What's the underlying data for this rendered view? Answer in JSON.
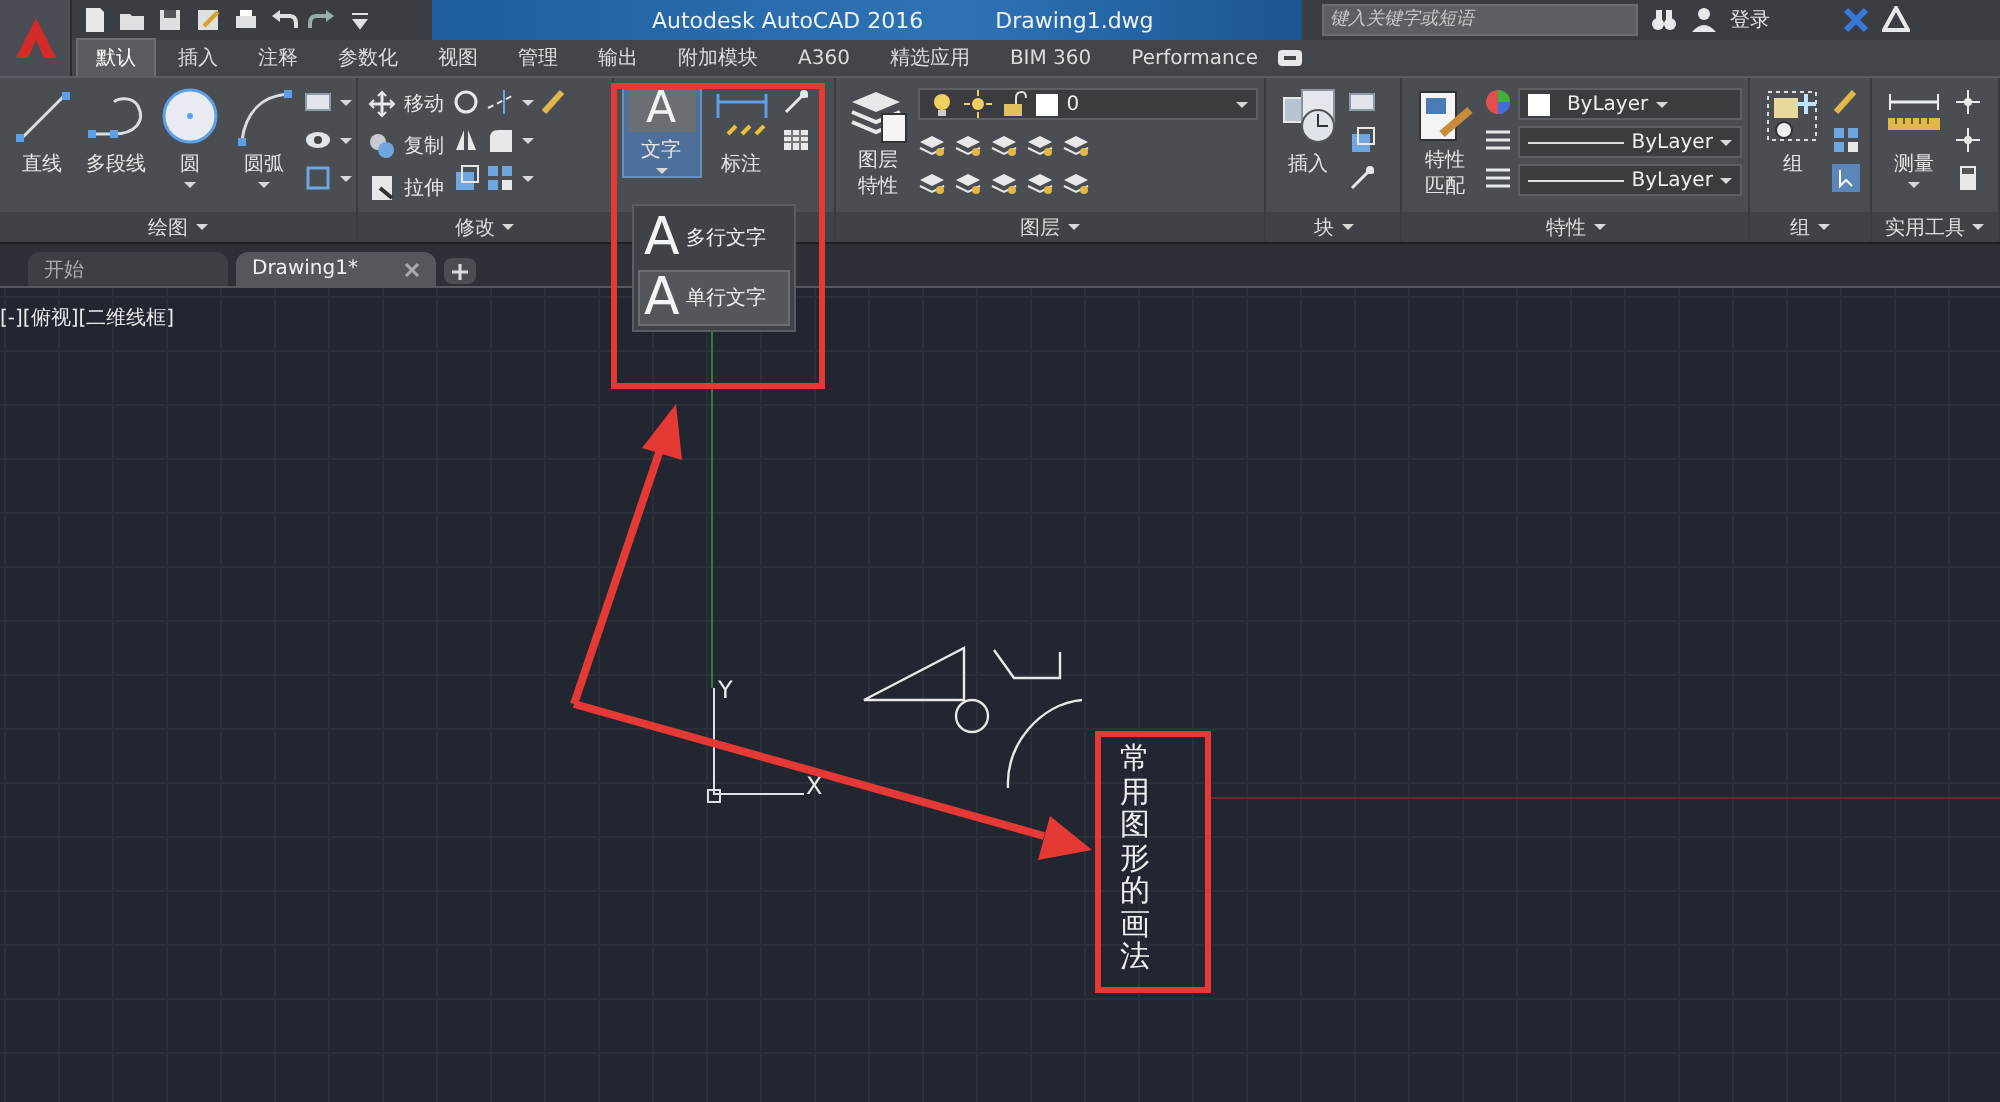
{
  "title_bar": {
    "title": "Autodesk AutoCAD 2016",
    "document": "Drawing1.dwg",
    "search": {
      "placeholder": "键入关键字或短语"
    },
    "sign_in": "登录"
  },
  "ribbon_tabs": [
    {
      "label": "默认",
      "selected": true
    },
    {
      "label": "插入",
      "selected": false
    },
    {
      "label": "注释",
      "selected": false
    },
    {
      "label": "参数化",
      "selected": false
    },
    {
      "label": "视图",
      "selected": false
    },
    {
      "label": "管理",
      "selected": false
    },
    {
      "label": "输出",
      "selected": false
    },
    {
      "label": "附加模块",
      "selected": false
    },
    {
      "label": "A360",
      "selected": false
    },
    {
      "label": "精选应用",
      "selected": false
    },
    {
      "label": "BIM 360",
      "selected": false
    },
    {
      "label": "Performance",
      "selected": false
    }
  ],
  "ribbon_panels": [
    {
      "kind": "draw",
      "title": "绘图",
      "tools": [
        {
          "kind": "line",
          "label": "直线"
        },
        {
          "kind": "polyline",
          "label": "多段线"
        },
        {
          "kind": "circle",
          "label": "圆"
        },
        {
          "kind": "arc",
          "label": "圆弧"
        }
      ]
    },
    {
      "kind": "modify",
      "title": "修改",
      "tools": [
        {
          "kind": "move",
          "label": "移动"
        },
        {
          "kind": "copy",
          "label": "复制"
        },
        {
          "kind": "stretch",
          "label": "拉伸"
        }
      ]
    },
    {
      "kind": "annotate",
      "tools": [
        {
          "kind": "text",
          "glyph": "A",
          "label": "文字",
          "active": true
        },
        {
          "kind": "dimension",
          "label": "标注",
          "active": false
        }
      ]
    },
    {
      "kind": "layers",
      "title": "图层",
      "tools": [
        {
          "kind": "layer-properties",
          "label": "图层特性"
        }
      ],
      "layer": "0"
    },
    {
      "kind": "block",
      "title": "块",
      "tools": [
        {
          "kind": "insert",
          "label": "插入"
        }
      ]
    },
    {
      "kind": "properties",
      "title": "特性",
      "tools": [
        {
          "kind": "match",
          "label": "特性匹配"
        }
      ],
      "dropdowns": [
        "ByLayer",
        "ByLayer",
        "ByLayer"
      ]
    },
    {
      "kind": "groups",
      "title": "组",
      "tools": [
        {
          "kind": "group",
          "label": "组"
        }
      ]
    },
    {
      "kind": "utilities",
      "title": "实用工具",
      "tools": [
        {
          "kind": "measure",
          "label": "测量"
        }
      ]
    }
  ],
  "document_tabs": [
    {
      "label": "开始",
      "selected": false
    },
    {
      "label": "Drawing1*",
      "selected": true
    }
  ],
  "viewport": {
    "label": "[-][俯视][二维线框]",
    "ucs": {
      "y": "Y",
      "x": "X"
    },
    "note": "常用图形的画法"
  },
  "text_menu": {
    "items": [
      {
        "glyph": "A",
        "label": "多行文字",
        "selected": false
      },
      {
        "glyph": "A",
        "label": "单行文字",
        "selected": true
      }
    ]
  }
}
